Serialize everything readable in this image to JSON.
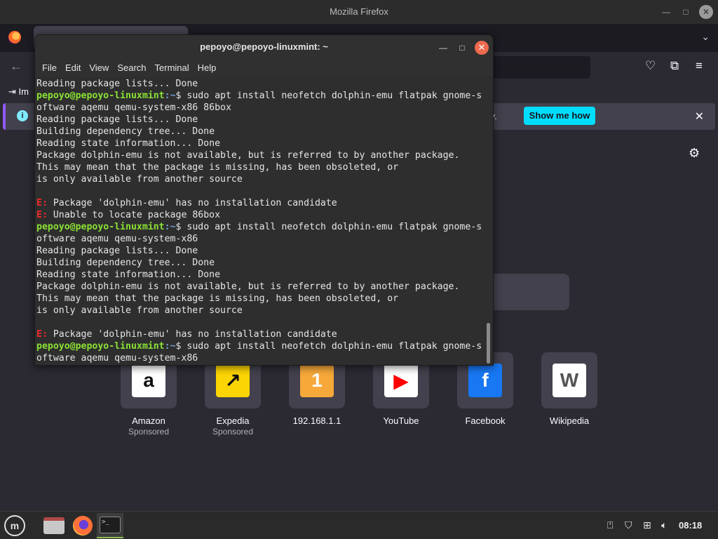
{
  "firefox": {
    "window_title": "Mozilla Firefox",
    "bookmark_import": "Im",
    "infobar": {
      "text": "ory.",
      "button": "Show me how",
      "info_glyph": "i",
      "close_glyph": "✕"
    },
    "tiles": [
      {
        "label": "Amazon",
        "sub": "Sponsored",
        "icon": "amazon-icon",
        "glyph": "a",
        "bg": "#ffffff",
        "fg": "#111111"
      },
      {
        "label": "Expedia",
        "sub": "Sponsored",
        "icon": "expedia-icon",
        "glyph": "↗",
        "bg": "#fcd504",
        "fg": "#111111"
      },
      {
        "label": "192.168.1.1",
        "sub": "",
        "icon": "number-one-icon",
        "glyph": "1",
        "bg": "#f7a83a",
        "fg": "#ffffff"
      },
      {
        "label": "YouTube",
        "sub": "",
        "icon": "youtube-icon",
        "glyph": "▶",
        "bg": "#ffffff",
        "fg": "#ff0000"
      },
      {
        "label": "Facebook",
        "sub": "",
        "icon": "facebook-icon",
        "glyph": "f",
        "bg": "#1877f2",
        "fg": "#ffffff"
      },
      {
        "label": "Wikipedia",
        "sub": "",
        "icon": "wikipedia-icon",
        "glyph": "W",
        "bg": "#ffffff",
        "fg": "#555555"
      }
    ]
  },
  "terminal": {
    "title": "pepoyo@pepoyo-linuxmint: ~",
    "menu": [
      "File",
      "Edit",
      "View",
      "Search",
      "Terminal",
      "Help"
    ],
    "prompt_user": "pepoyo@pepoyo-linuxmint",
    "prompt_sep": ":~",
    "lines": [
      {
        "type": "text",
        "text": "Reading package lists... Done"
      },
      {
        "type": "prompt",
        "cmd": "$ sudo apt install neofetch dolphin-emu flatpak gnome-s"
      },
      {
        "type": "text",
        "text": "oftware aqemu qemu-system-x86 86box"
      },
      {
        "type": "text",
        "text": "Reading package lists... Done"
      },
      {
        "type": "text",
        "text": "Building dependency tree... Done"
      },
      {
        "type": "text",
        "text": "Reading state information... Done"
      },
      {
        "type": "text",
        "text": "Package dolphin-emu is not available, but is referred to by another package."
      },
      {
        "type": "text",
        "text": "This may mean that the package is missing, has been obsoleted, or"
      },
      {
        "type": "text",
        "text": "is only available from another source"
      },
      {
        "type": "text",
        "text": ""
      },
      {
        "type": "error",
        "tag": "E:",
        "text": " Package 'dolphin-emu' has no installation candidate"
      },
      {
        "type": "error",
        "tag": "E:",
        "text": " Unable to locate package 86box"
      },
      {
        "type": "prompt",
        "cmd": "$ sudo apt install neofetch dolphin-emu flatpak gnome-s"
      },
      {
        "type": "text",
        "text": "oftware aqemu qemu-system-x86"
      },
      {
        "type": "text",
        "text": "Reading package lists... Done"
      },
      {
        "type": "text",
        "text": "Building dependency tree... Done"
      },
      {
        "type": "text",
        "text": "Reading state information... Done"
      },
      {
        "type": "text",
        "text": "Package dolphin-emu is not available, but is referred to by another package."
      },
      {
        "type": "text",
        "text": "This may mean that the package is missing, has been obsoleted, or"
      },
      {
        "type": "text",
        "text": "is only available from another source"
      },
      {
        "type": "text",
        "text": ""
      },
      {
        "type": "error",
        "tag": "E:",
        "text": " Package 'dolphin-emu' has no installation candidate"
      },
      {
        "type": "prompt",
        "cmd": "$ sudo apt install neofetch dolphin-emu flatpak gnome-s"
      },
      {
        "type": "text",
        "text": "oftware aqemu qemu-system-x86"
      }
    ]
  },
  "taskbar": {
    "clock": "08:18",
    "term_icon_glyph": ">_"
  },
  "colors": {
    "prompt_user": "#8ae234",
    "prompt_sep": "#729fcf",
    "error": "#ef2929",
    "show_me_how_bg": "#00ddff"
  }
}
